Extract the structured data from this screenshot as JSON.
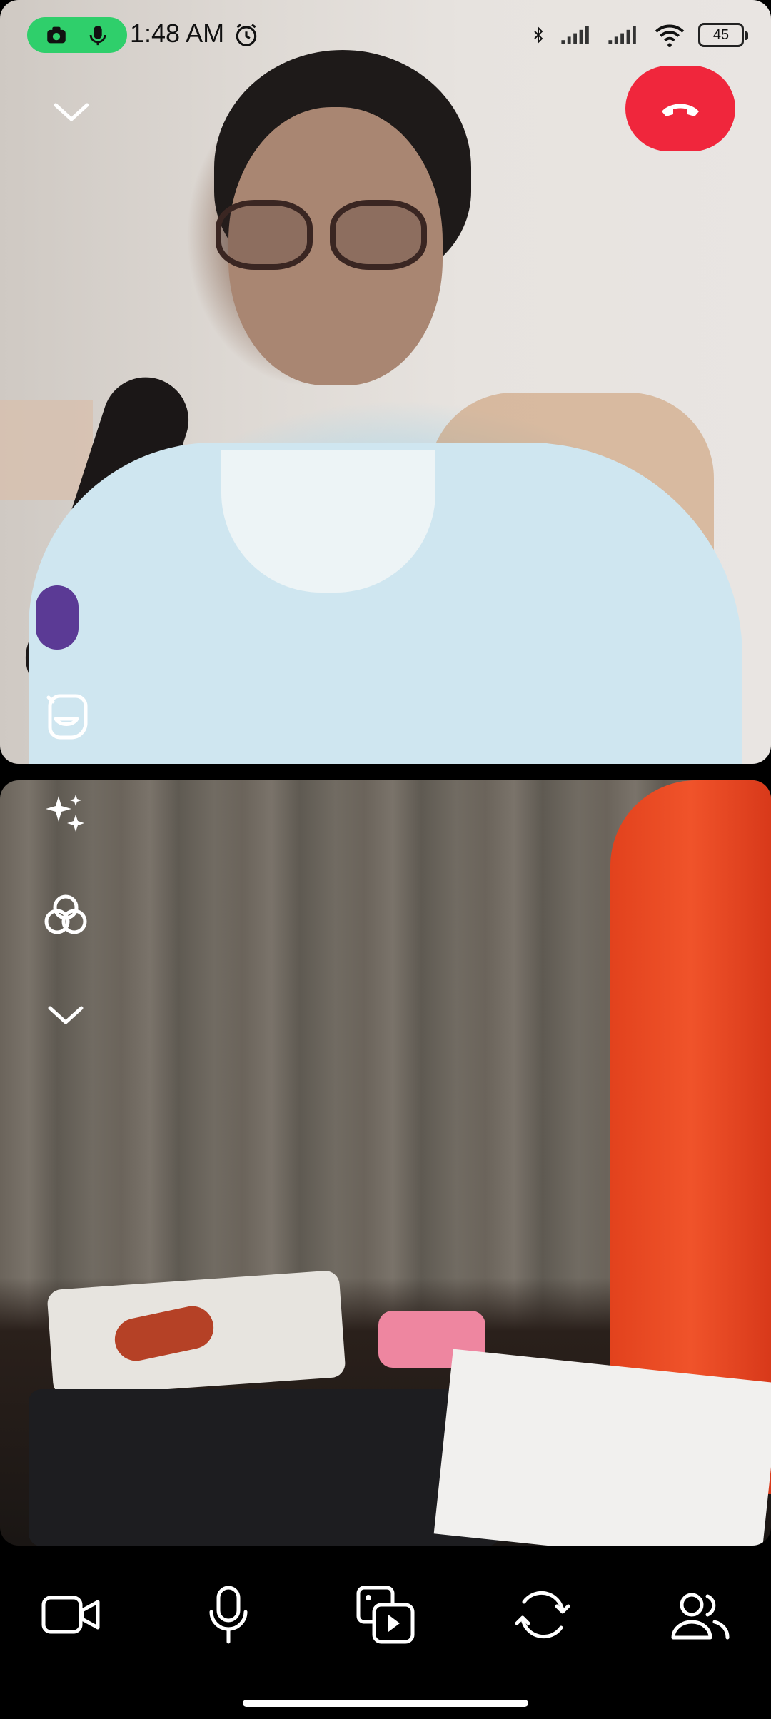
{
  "status_bar": {
    "time": "1:48 AM",
    "battery": "45",
    "icons": [
      "camera-recording-icon",
      "mic-recording-icon",
      "alarm-icon",
      "bluetooth-icon",
      "signal-icon",
      "signal-icon",
      "wifi-icon",
      "battery-icon"
    ],
    "recording_indicator_color": "#2fcf6b"
  },
  "call": {
    "end_call_color": "#f0263c",
    "top_controls": [
      "chevron-down-icon",
      "end-call-icon"
    ],
    "side_effects": [
      "sticker-icon",
      "sparkles-icon",
      "filters-icon",
      "chevron-down-icon"
    ]
  },
  "bottom_controls": {
    "buttons": [
      "video-camera-icon",
      "microphone-icon",
      "media-share-icon",
      "switch-camera-icon",
      "participants-icon"
    ]
  }
}
